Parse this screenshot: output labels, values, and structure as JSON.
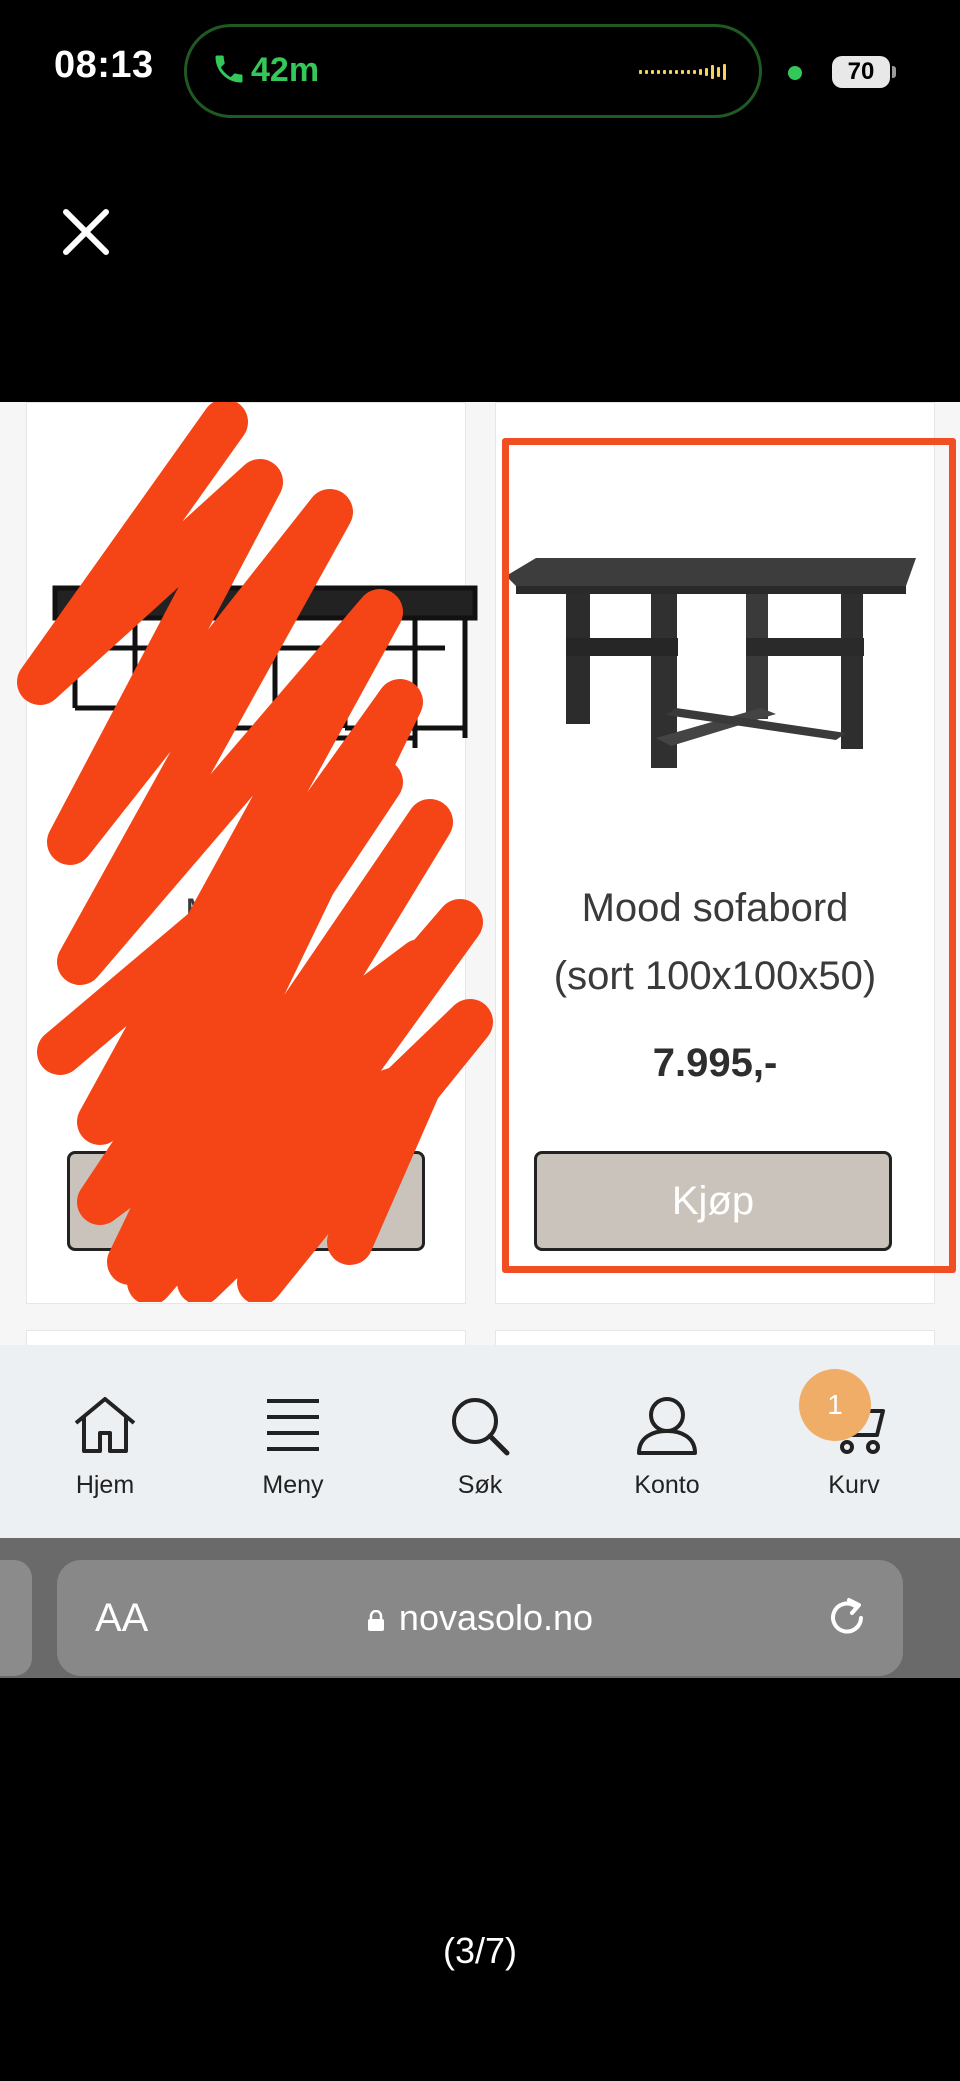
{
  "status_bar": {
    "time": "08:13",
    "call_duration": "42m",
    "battery": "70"
  },
  "viewer": {
    "close_icon": "close-icon",
    "pager": "(3/7)"
  },
  "products": [
    {
      "name_visible_fragments": "Mo d tt",
      "buy_label": "Kjøp",
      "obscured": true
    },
    {
      "name_line1": "Mood sofabord",
      "name_line2": "(sort 100x100x50)",
      "price": "7.995,-",
      "buy_label": "Kjøp",
      "highlighted": true
    }
  ],
  "tabbar": {
    "items": [
      {
        "label": "Hjem",
        "icon": "home-icon"
      },
      {
        "label": "Meny",
        "icon": "menu-icon"
      },
      {
        "label": "Søk",
        "icon": "search-icon"
      },
      {
        "label": "Konto",
        "icon": "account-icon"
      },
      {
        "label": "Kurv",
        "icon": "cart-icon"
      }
    ],
    "cart_count": "1"
  },
  "safari": {
    "aa_label": "AA",
    "url": "novasolo.no"
  },
  "colors": {
    "annotation": "#f04e23",
    "buy_button": "#cac3bb",
    "cart_badge": "#f0ad67",
    "call_green": "#34c759"
  }
}
